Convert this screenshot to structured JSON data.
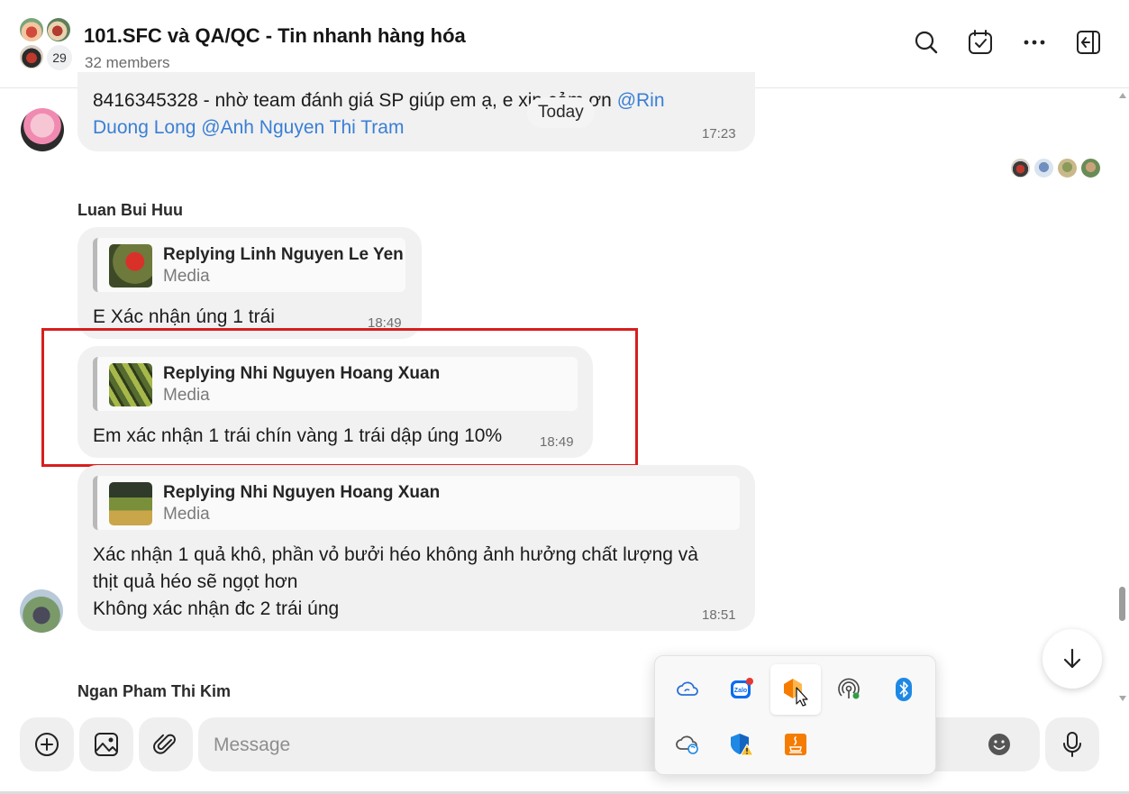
{
  "header": {
    "title": "101.SFC và QA/QC - Tin nhanh hàng hóa",
    "members": "32 members",
    "avatar_count": "29"
  },
  "messages": {
    "top": {
      "line1": "8416345328 - nhờ team đánh giá SP giúp em ạ, e xin cảm ơn ",
      "mention1": "@Rin",
      "line2_mention": "Duong Long",
      "line2_mention2": "@Anh Nguyen Thi Tram",
      "time": "17:23"
    },
    "today_label": "Today",
    "luan": {
      "sender": "Luan Bui Huu",
      "m1": {
        "reply_title": "Replying Linh Nguyen Le Yen",
        "reply_sub": "Media",
        "text": "E Xác nhận úng 1 trái",
        "time": "18:49"
      },
      "m2": {
        "reply_title": "Replying Nhi Nguyen Hoang Xuan",
        "reply_sub": "Media",
        "text": "Em xác nhận 1 trái chín vàng 1 trái dập úng 10%",
        "time": "18:49"
      },
      "m3": {
        "reply_title": "Replying Nhi Nguyen Hoang Xuan",
        "reply_sub": "Media",
        "line1": "Xác nhận 1 quả khô, phần vỏ bưởi héo không ảnh hưởng chất lượng và",
        "line2": "thịt quả héo sẽ ngọt hơn",
        "line3": "Không xác nhận đc 2 trái úng",
        "time": "18:51"
      }
    },
    "next_sender": "Ngan Pham Thi Kim"
  },
  "composer": {
    "placeholder": "Message"
  },
  "tray": {
    "zalo_label": "Zalo"
  },
  "colors": {
    "accent": "#3a7fd5",
    "highlight": "#d81e1e",
    "bubble": "#f1f1f1"
  }
}
